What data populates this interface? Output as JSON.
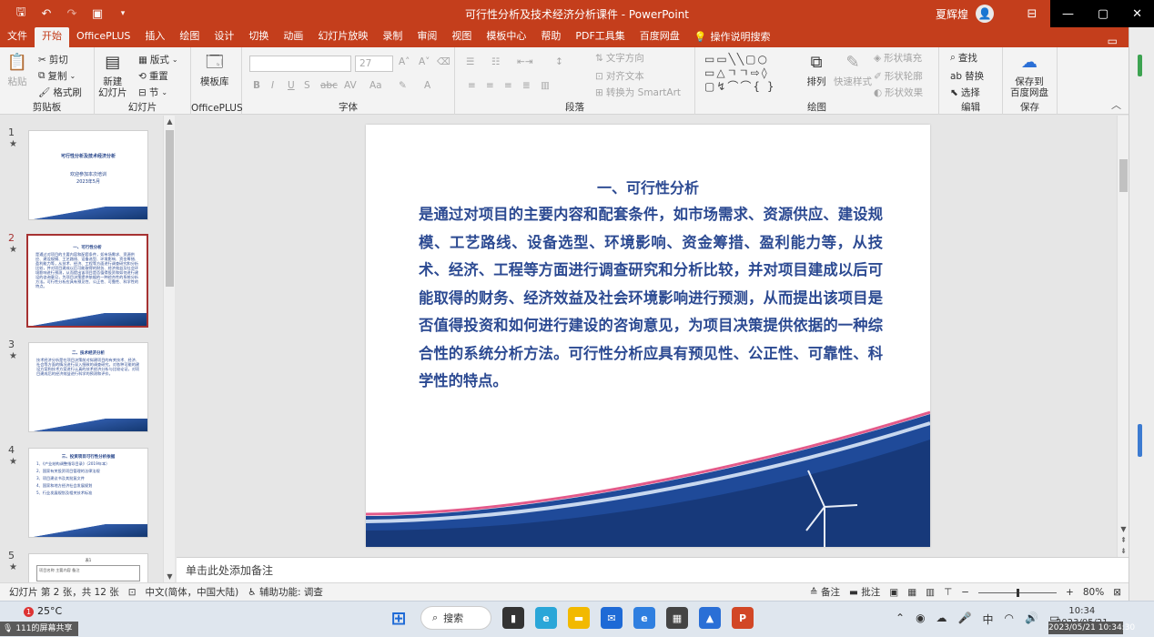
{
  "window": {
    "title": "可行性分析及技术经济分析课件 - PowerPoint",
    "user": "夏辉煌"
  },
  "quick_access": [
    "save-icon",
    "undo-icon",
    "redo-icon",
    "present-icon",
    "customize-icon"
  ],
  "tabs": [
    {
      "label": "文件"
    },
    {
      "label": "开始",
      "active": true
    },
    {
      "label": "OfficePLUS"
    },
    {
      "label": "插入"
    },
    {
      "label": "绘图"
    },
    {
      "label": "设计"
    },
    {
      "label": "切换"
    },
    {
      "label": "动画"
    },
    {
      "label": "幻灯片放映"
    },
    {
      "label": "录制"
    },
    {
      "label": "审阅"
    },
    {
      "label": "视图"
    },
    {
      "label": "模板中心"
    },
    {
      "label": "帮助"
    },
    {
      "label": "PDF工具集"
    },
    {
      "label": "百度网盘"
    }
  ],
  "tell_me": "操作说明搜索",
  "ribbon": {
    "clipboard": {
      "paste": "粘贴",
      "cut": "剪切",
      "copy": "复制",
      "format_painter": "格式刷",
      "label": "剪贴板"
    },
    "slides": {
      "new_slide": "新建\n幻灯片",
      "layout": "版式",
      "reset": "重置",
      "section": "节",
      "label": "幻灯片"
    },
    "officeplus": {
      "templates": "模板库",
      "label": "OfficePLUS"
    },
    "font": {
      "size": "27",
      "label": "字体",
      "bold": "B",
      "italic": "I",
      "underline": "U",
      "shadow": "S",
      "strike": "abc",
      "spacing": "AV",
      "case": "Aa"
    },
    "paragraph": {
      "text_direction": "文字方向",
      "align_text": "对齐文本",
      "smartart": "转换为 SmartArt",
      "label": "段落"
    },
    "drawing": {
      "arrange": "排列",
      "quick_styles": "快速样式",
      "shape_fill": "形状填充",
      "shape_outline": "形状轮廓",
      "shape_effects": "形状效果",
      "label": "绘图"
    },
    "editing": {
      "find": "查找",
      "replace": "替换",
      "select": "选择",
      "label": "编辑"
    },
    "save": {
      "save_baidu": "保存到\n百度网盘",
      "label": "保存"
    }
  },
  "thumbnails": [
    {
      "num": "1",
      "title": "可行性分析及技术经济分析",
      "lines": [
        "欢迎参加本次培训",
        "2023年5月"
      ]
    },
    {
      "num": "2",
      "title": "一、可行性分析",
      "lines": [
        "是通过对项目的主要内容和配套条件，如市场需求、资源供应、建设规模、工艺路线、设备选型、环境影响、资金筹措、盈利能力等，从技术、经济、工程等方面进行调查研究和分析比较，并对项目建成以后可能取得的财务、经济效益及社会环境影响进行预测，从而提出该项目是否值得投资和如何进行建设的咨询意见，为项目决策提供依据的一种综合性的系统分析方法。可行性分析应具有预见性、公正性、可靠性、科学性的特点。"
      ]
    },
    {
      "num": "3",
      "title": "二、技术经济分析",
      "lines": [
        "技术经济分析是在项目决策前对拟建项目的有关技术、经济、社会等方面的情况进行深入细致的调查研究，对各种可能的建设方案和技术方案进行认真的技术经济分析与比较论证，对项目建成后的经济效益进行科学的预测和评价。"
      ]
    },
    {
      "num": "4",
      "title": "三、投资项目可行性分析依据",
      "lines": [
        "1、《产业结构调整指导目录》（2019年本）",
        "2、国家有关投资项目管理的法律法规",
        "3、项目建议书及其批复文件",
        "4、国家和地方经济社会发展规划",
        "5、行业发展规划及相关技术标准"
      ]
    },
    {
      "num": "5",
      "title": "表1",
      "lines": [
        "项目名称 主要内容 备注"
      ]
    }
  ],
  "slide": {
    "title": "一、可行性分析",
    "body": "是通过对项目的主要内容和配套条件，如市场需求、资源供应、建设规模、工艺路线、设备选型、环境影响、资金筹措、盈利能力等，从技术、经济、工程等方面进行调查研究和分析比较，并对项目建成以后可能取得的财务、经济效益及社会环境影响进行预测，从而提出该项目是否值得投资和如何进行建设的咨询意见，为项目决策提供依据的一种综合性的系统分析方法。可行性分析应具有预见性、公正性、可靠性、科学性的特点。"
  },
  "notes_placeholder": "单击此处添加备注",
  "status": {
    "slide_info": "幻灯片 第 2 张，共 12 张",
    "language": "中文(简体，中国大陆)",
    "accessibility": "辅助功能: 调查",
    "notes_btn": "备注",
    "comments_btn": "批注",
    "zoom": "80%",
    "zoom_fraction": 0.5
  },
  "taskbar": {
    "weather": "25°C",
    "weather_badge": "1",
    "recording": "111的屏幕共享",
    "search": "搜索",
    "time": "10:34",
    "date": "2023/05/21",
    "datestamp": "2023/05/21 10:34:30",
    "ime": "中"
  },
  "colors": {
    "accent": "#c43e1c",
    "slide_text": "#2c4a92",
    "selected_thumb": "#a63232"
  }
}
